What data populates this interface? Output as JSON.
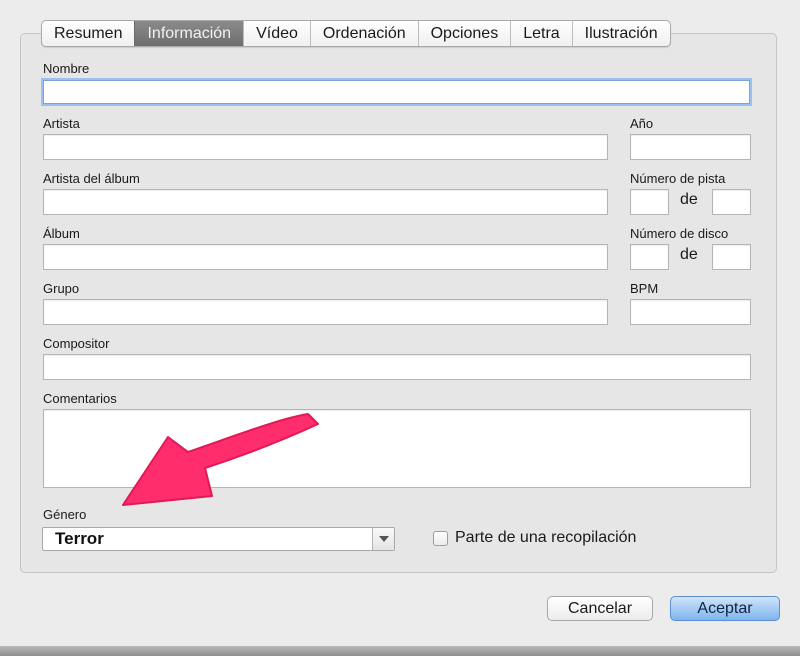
{
  "tabs": [
    {
      "label": "Resumen",
      "active": false
    },
    {
      "label": "Información",
      "active": true
    },
    {
      "label": "Vídeo",
      "active": false
    },
    {
      "label": "Ordenación",
      "active": false
    },
    {
      "label": "Opciones",
      "active": false
    },
    {
      "label": "Letra",
      "active": false
    },
    {
      "label": "Ilustración",
      "active": false
    }
  ],
  "fields": {
    "nombre_label": "Nombre",
    "artista_label": "Artista",
    "anio_label": "Año",
    "artista_album_label": "Artista del álbum",
    "numero_pista_label": "Número de pista",
    "album_label": "Álbum",
    "numero_disco_label": "Número de disco",
    "de_label": "de",
    "grupo_label": "Grupo",
    "bpm_label": "BPM",
    "compositor_label": "Compositor",
    "comentarios_label": "Comentarios",
    "genero_label": "Género",
    "genero_value": "Terror"
  },
  "checkbox": {
    "label": "Parte de una recopilación",
    "checked": false
  },
  "buttons": {
    "cancel": "Cancelar",
    "ok": "Aceptar"
  },
  "colors": {
    "accent_arrow": "#ff2d6b",
    "default_button": "#7fb4ee",
    "focus_ring": "#9cc0ef"
  }
}
